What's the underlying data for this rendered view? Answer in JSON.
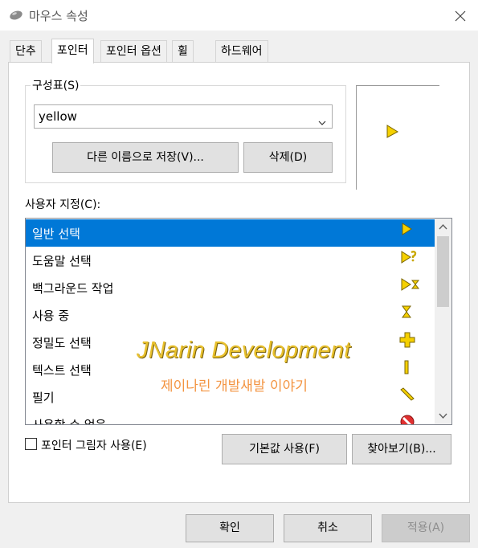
{
  "window": {
    "title": "마우스 속성"
  },
  "tabs": [
    {
      "label": "단추"
    },
    {
      "label": "포인터"
    },
    {
      "label": "포인터 옵션"
    },
    {
      "label": "휠"
    },
    {
      "label": "하드웨어"
    }
  ],
  "scheme": {
    "group_label": "구성표(S)",
    "selected": "yellow",
    "save_as_label": "다른 이름으로 저장(V)...",
    "delete_label": "삭제(D)"
  },
  "customize": {
    "label": "사용자 지정(C):",
    "items": [
      {
        "label": "일반 선택",
        "icon": "arrow-cursor-icon"
      },
      {
        "label": "도움말 선택",
        "icon": "help-cursor-icon"
      },
      {
        "label": "백그라운드 작업",
        "icon": "working-cursor-icon"
      },
      {
        "label": "사용 중",
        "icon": "hourglass-cursor-icon"
      },
      {
        "label": "정밀도 선택",
        "icon": "precision-cursor-icon"
      },
      {
        "label": "텍스트 선택",
        "icon": "text-cursor-icon"
      },
      {
        "label": "필기",
        "icon": "handwriting-cursor-icon"
      },
      {
        "label": "사용할 수 없음",
        "icon": "unavailable-cursor-icon"
      }
    ],
    "selected_index": 0
  },
  "watermark": {
    "line1": "JNarin Development",
    "line2": "제이나린 개발새발 이야기"
  },
  "shadow_checkbox": {
    "label": "포인터 그림자 사용(E)",
    "checked": false
  },
  "defaults_button": "기본값 사용(F)",
  "browse_button": "찾아보기(B)...",
  "footer": {
    "ok": "확인",
    "cancel": "취소",
    "apply": "적용(A)"
  },
  "colors": {
    "selection": "#0078d7",
    "cursor_yellow": "#f5d000",
    "watermark_yellow": "#e8c02c",
    "watermark_orange": "#f39441"
  }
}
